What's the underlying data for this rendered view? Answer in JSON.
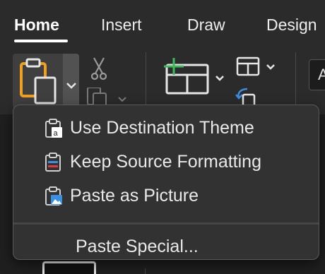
{
  "tabs": [
    {
      "label": "Home",
      "active": true
    },
    {
      "label": "Insert"
    },
    {
      "label": "Draw"
    },
    {
      "label": "Design"
    }
  ],
  "ribbon": {
    "font_box_text": "A",
    "icons": [
      "paste-icon",
      "cut-icon",
      "copy-icon",
      "new-slide-icon",
      "layout-icon",
      "reset-icon"
    ]
  },
  "paste_menu": {
    "items": [
      {
        "label": "Use Destination Theme",
        "icon": "paste-destination-theme-icon"
      },
      {
        "label": "Keep Source Formatting",
        "icon": "paste-keep-source-icon"
      },
      {
        "label": "Paste as Picture",
        "icon": "paste-picture-icon"
      }
    ],
    "special": {
      "label": "Paste Special..."
    }
  },
  "colors": {
    "background": "#262626",
    "menu_bg": "#323232",
    "paste_accent": "#f0a020",
    "new_slide_plus": "#3dbb5c",
    "reset_arrow": "#3a8fe0"
  }
}
